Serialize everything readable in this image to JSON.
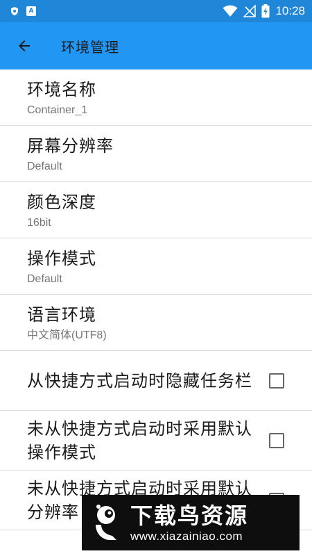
{
  "status_bar": {
    "time": "10:28",
    "icons": [
      "shield-icon",
      "a-letter-icon",
      "wifi-icon",
      "signal-off-icon",
      "battery-charging-icon"
    ],
    "a_icon_label": "A"
  },
  "app_bar": {
    "title": "环境管理",
    "back_icon": "arrow-left-icon"
  },
  "settings": [
    {
      "title": "环境名称",
      "value": "Container_1"
    },
    {
      "title": "屏幕分辨率",
      "value": "Default"
    },
    {
      "title": "颜色深度",
      "value": "16bit"
    },
    {
      "title": "操作模式",
      "value": "Default"
    },
    {
      "title": "语言环境",
      "value": "中文简体(UTF8)"
    }
  ],
  "checkboxes": [
    {
      "label": "从快捷方式启动时隐藏任务栏",
      "checked": false
    },
    {
      "label": "未从快捷方式启动时采用默认操作模式",
      "checked": false
    },
    {
      "label": "未从快捷方式启动时采用默认分辨率",
      "checked": false
    }
  ],
  "watermark": {
    "title": "下载鸟资源",
    "url": "www.xiazainiao.com"
  },
  "colors": {
    "status_bar": "#1f86d8",
    "app_bar": "#2196f3",
    "divider": "#dcdcdc",
    "subtitle": "#757575"
  }
}
